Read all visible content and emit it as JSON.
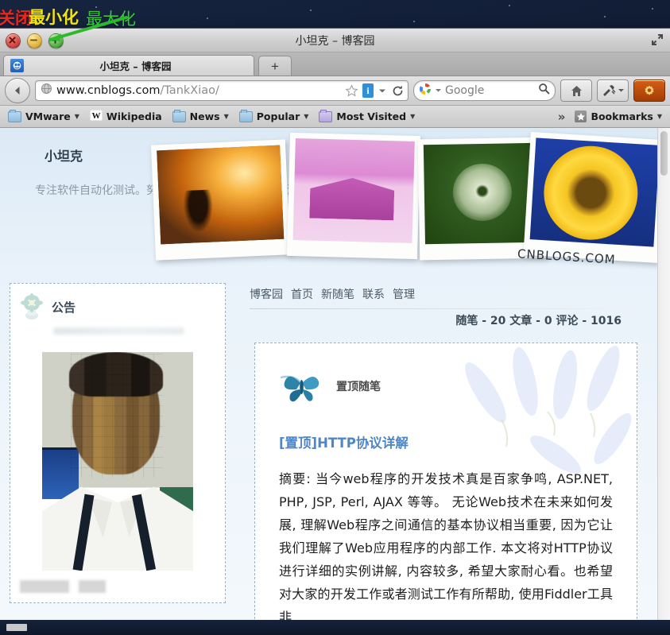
{
  "desktop": {
    "annotations": [
      {
        "name": "close-annotation",
        "text": "关闭",
        "color": "#e8281d"
      },
      {
        "name": "minimize-annotation",
        "text": "最小化",
        "color": "#f3e312"
      },
      {
        "name": "maximize-annotation",
        "text": "最大化",
        "color": "#35c93a"
      }
    ]
  },
  "window": {
    "title": "小坦克 – 博客园",
    "controls": {
      "close": "close-button",
      "minimize": "minimize-button",
      "maximize": "maximize-button"
    },
    "restore_icon": "restore-window-icon"
  },
  "tabs": {
    "items": [
      {
        "title": "小坦克 – 博客园",
        "favicon": "firefox-page-icon"
      }
    ],
    "new_tab_label": "+"
  },
  "navbar": {
    "back_label": "Back",
    "url_domain": "www.cnblogs.com",
    "url_path": "/TankXiao/",
    "identity_label": "i",
    "search_engine": "Google",
    "icons": {
      "globe": "globe-icon",
      "star": "bookmark-star-icon",
      "reload": "reload-icon",
      "home": "home-icon",
      "tools": "tools-icon",
      "settings": "settings-gear-icon"
    }
  },
  "bookmarks": {
    "items": [
      {
        "label": "VMware",
        "icon": "folder-icon",
        "has_caret": true
      },
      {
        "label": "Wikipedia",
        "icon": "wikipedia-icon",
        "has_caret": false
      },
      {
        "label": "News",
        "icon": "folder-icon",
        "has_caret": true
      },
      {
        "label": "Popular",
        "icon": "folder-icon",
        "has_caret": true
      },
      {
        "label": "Most Visited",
        "icon": "folder-purple-icon",
        "has_caret": true
      }
    ],
    "overflow_label": "»",
    "menu_label": "Bookmarks"
  },
  "blog": {
    "title": "小坦克",
    "subtitle": "专注软件自动化测试。努力学习开发技术, 用到软件测试上",
    "banner_watermark": "CNBLOGS.COM",
    "photos": [
      {
        "name": "sunset-tree-photo"
      },
      {
        "name": "purple-barn-photo"
      },
      {
        "name": "dandelion-photo"
      },
      {
        "name": "sunflower-photo"
      }
    ],
    "nav": [
      {
        "label": "博客园"
      },
      {
        "label": "首页"
      },
      {
        "label": "新随笔"
      },
      {
        "label": "联系"
      },
      {
        "label": "管理"
      }
    ],
    "stats": "随笔 - 20  文章 - 0  评论 - 1016",
    "sidebar": {
      "announce_title": "公告",
      "announce_icon": "flower-icon",
      "avatar_alt": "blurred-portrait-photo"
    },
    "post": {
      "pinned_label": "置顶随笔",
      "butterfly_icon": "butterfly-icon",
      "title": "[置顶]HTTP协议详解",
      "excerpt": "摘要: 当今web程序的开发技术真是百家争鸣,  ASP.NET, PHP, JSP,  Perl, AJAX 等等。 无论Web技术在未来如何发展, 理解Web程序之间通信的基本协议相当重要, 因为它让我们理解了Web应用程序的内部工作. 本文将对HTTP协议进行详细的实例讲解, 内容较多, 希望大家耐心看。也希望对大家的开发工作或者测试工作有所帮助, 使用Fiddler工具非"
    }
  },
  "scrollbar": {
    "name": "page-vertical-scrollbar"
  }
}
